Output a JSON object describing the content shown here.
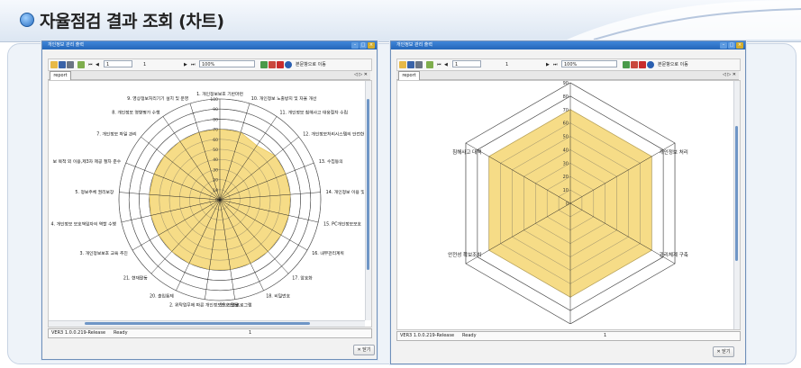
{
  "header": {
    "title": "자율점검 결과 조회 (차트)"
  },
  "left_window": {
    "title": "개인정보 관리 출력",
    "toolbar": {
      "page_current": "1",
      "page_total": "1",
      "zoom": "100%",
      "goto_label": "본문항으로 이동"
    },
    "tab": "report",
    "page_indicator": "◁ ▷ ✕",
    "status": {
      "version": "VER3 1.0.0.219-Release",
      "state": "Ready",
      "page": "1"
    },
    "close_label": "✕ 닫기"
  },
  "right_window": {
    "title": "개인정보 관리 출력",
    "toolbar": {
      "page_current": "1",
      "page_total": "1",
      "zoom": "100%",
      "goto_label": "본문항으로 이동"
    },
    "tab": "report",
    "page_indicator": "◁ ▷ ✕",
    "status": {
      "version": "VER3 1.0.0.219-Release",
      "state": "Ready",
      "page": "1"
    },
    "close_label": "✕ 닫기"
  },
  "chart_data": [
    {
      "type": "radar",
      "categories": [
        "1. 개인정보보호 기반마련",
        "10. 개인정보 노출방지 및 자율 개선",
        "11. 개인정보 침해사고 대응절차 수립",
        "12. 개인정보처리시스템의 안전한 이",
        "13. 수집동의",
        "14. 개인정보 이용 및 관리",
        "15. PC개인정보보호",
        "16. 내부관리계획",
        "17. 암호화",
        "18. 비밀번호",
        "19. 보안프로그램",
        "2. 위탁업무에 따른 개인정보보호 활동",
        "20. 출입통제",
        "21. 현재활동",
        "3. 개인정보보호 교육 추진",
        "4. 개인정보 보호책임자의 역할 수행",
        "5. 정보주체 권리보장",
        "보 목적 외 이용,제3자 제공 절차 준수",
        "7. 개인정보 파일 관리",
        "8. 개인정보 영향평가 수행",
        "9. 영상정보처리기기 설치 및 운영"
      ],
      "values": [
        70,
        70,
        65,
        70,
        70,
        70,
        70,
        70,
        70,
        70,
        70,
        70,
        70,
        70,
        70,
        70,
        70,
        70,
        70,
        70,
        70
      ],
      "rmax": 100,
      "ticks": [
        0,
        10,
        20,
        30,
        40,
        50,
        60,
        70,
        80,
        90,
        100
      ],
      "fill_color": "#f5d87a"
    },
    {
      "type": "radar",
      "categories": [
        "",
        "개인정보 처리",
        "관리체계 구축",
        "",
        "안전성 확보조치",
        "침해사고 대책"
      ],
      "values": [
        70,
        70,
        70,
        70,
        70,
        70
      ],
      "rmax": 90,
      "ticks": [
        0,
        10,
        20,
        30,
        40,
        50,
        60,
        70,
        80,
        90
      ],
      "fill_color": "#f5d87a"
    }
  ]
}
